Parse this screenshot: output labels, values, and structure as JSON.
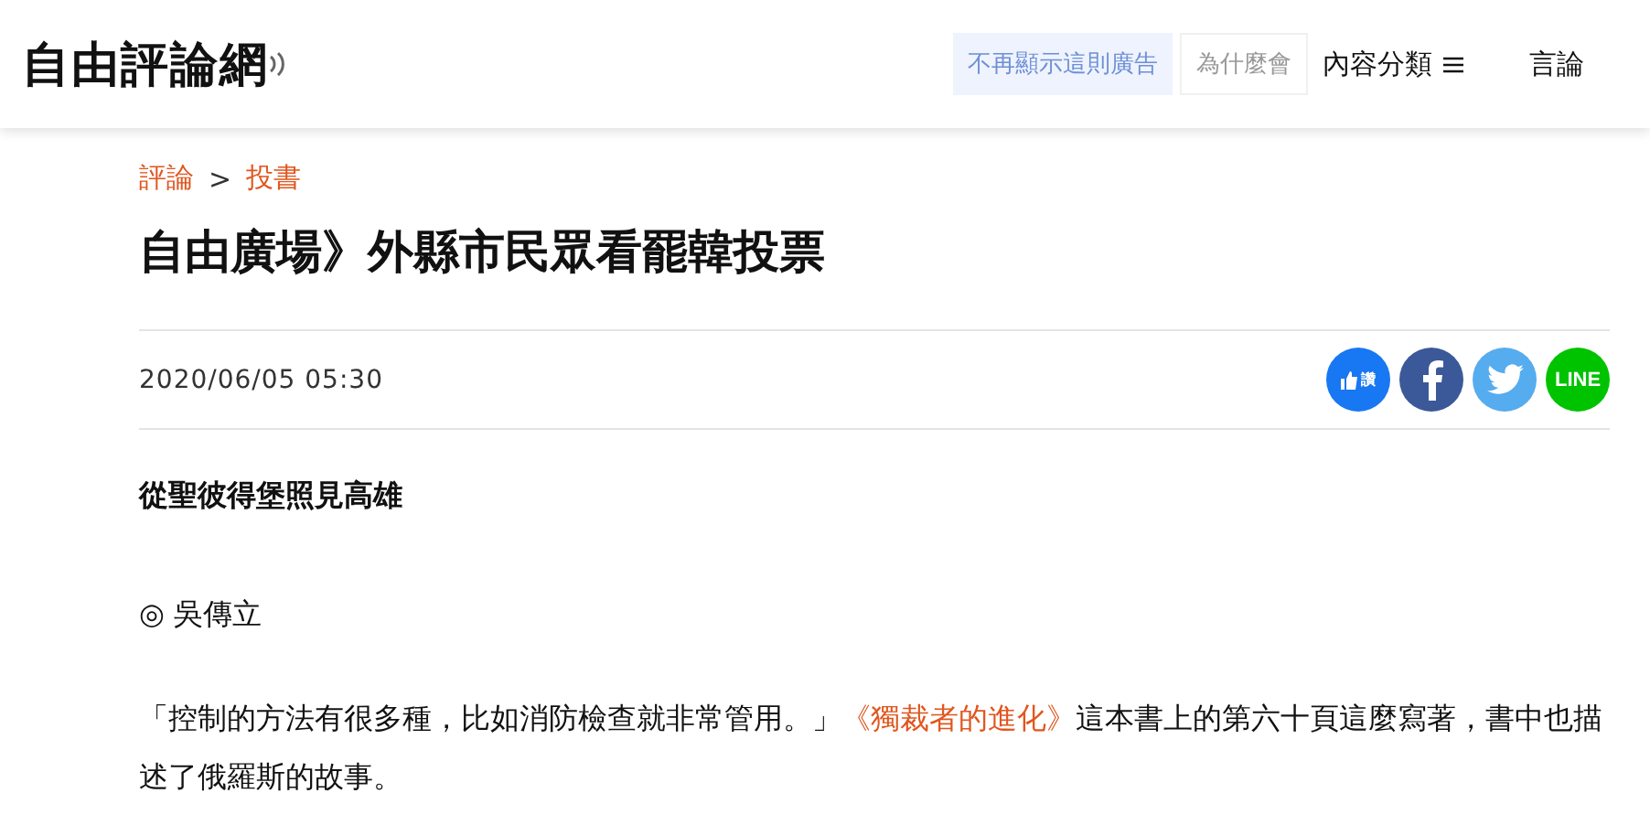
{
  "header": {
    "logo": "自由評論網",
    "ad_notice": {
      "hide_button": "不再顯示這則廣告",
      "why_button": "為什麼會"
    },
    "nav": [
      {
        "label": "內容分類",
        "kind": "menu"
      },
      {
        "label": "言論",
        "kind": "link"
      }
    ]
  },
  "breadcrumb": [
    "評論",
    "投書"
  ],
  "breadcrumb_separator": ">",
  "title": "自由廣場》外縣市民眾看罷韓投票",
  "date": "2020/06/05 05:30",
  "share": [
    {
      "kind": "like",
      "label": "讚",
      "color": "#1877f2"
    },
    {
      "kind": "facebook",
      "color": "#3b5998"
    },
    {
      "kind": "twitter",
      "color": "#55acee"
    },
    {
      "kind": "line",
      "label": "LINE",
      "color": "#00c300"
    }
  ],
  "body": [
    {
      "kind": "subtitle",
      "text": "從聖彼得堡照見高雄"
    },
    {
      "kind": "author",
      "text": "◎ 吳傳立"
    },
    {
      "kind": "paragraph",
      "before": "「控制的方法有很多種，比如消防檢查就非常管用。」",
      "link": "《獨裁者的進化》",
      "after": "這本書上的第六十頁這麼寫著，書中也描述了俄羅斯的故事。"
    }
  ]
}
